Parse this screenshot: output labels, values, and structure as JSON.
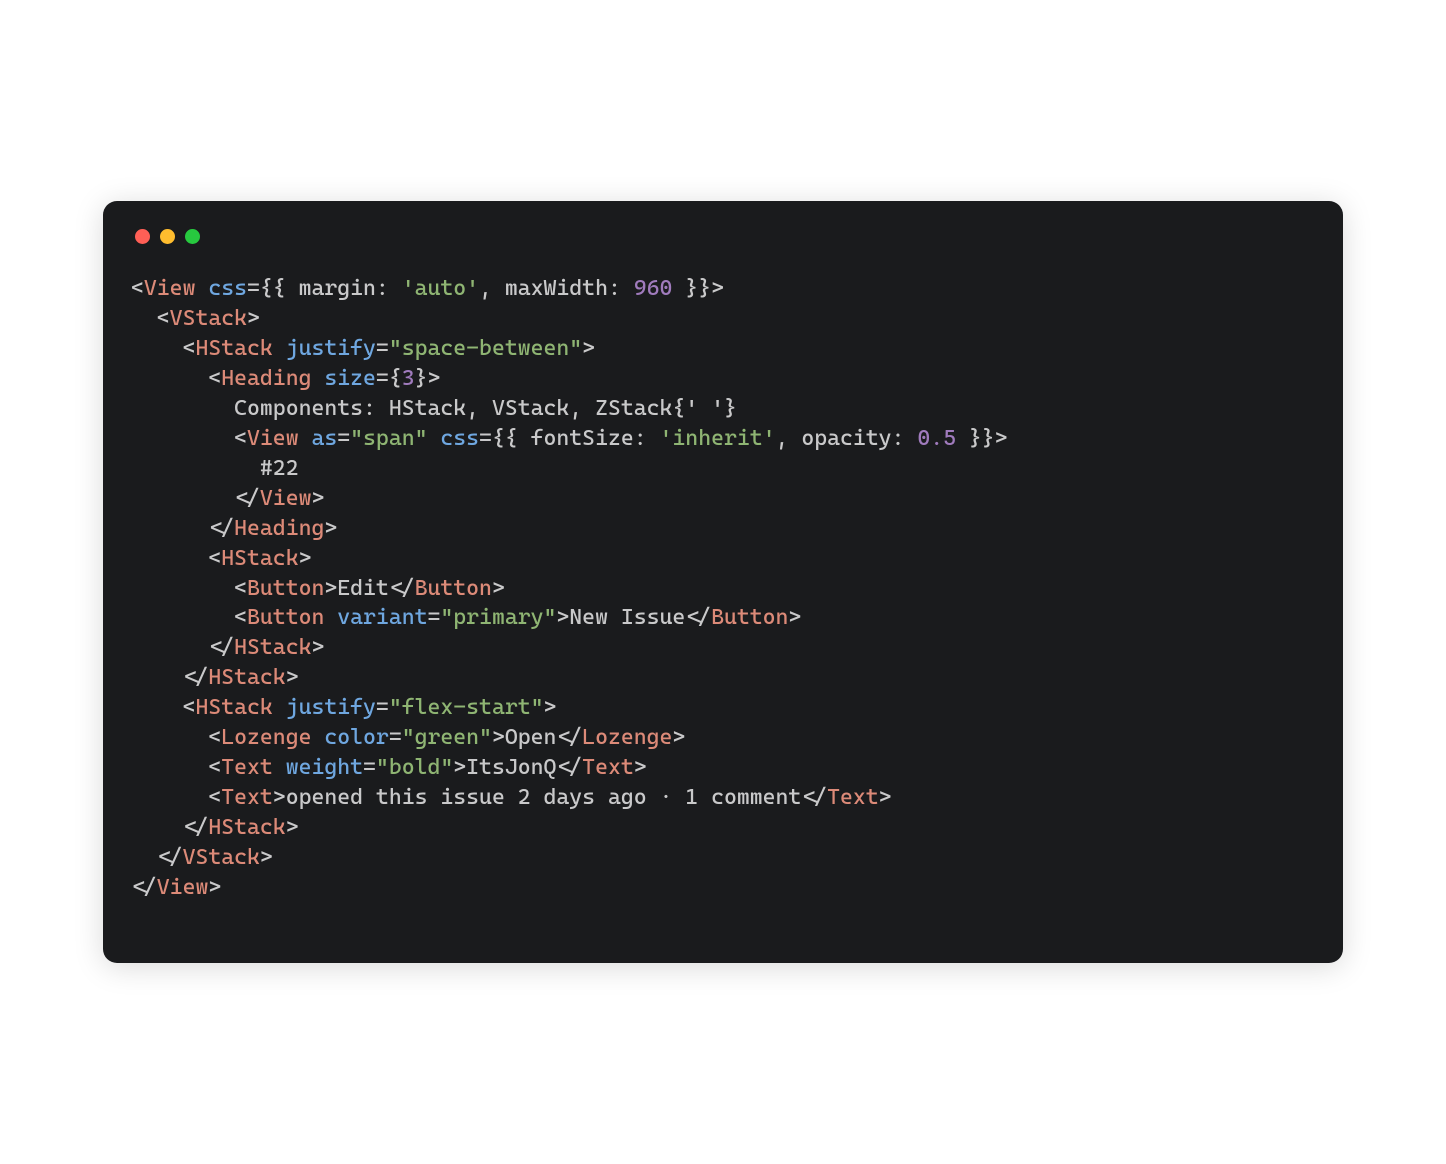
{
  "code": {
    "line1": {
      "tag": "View",
      "attr_css": "css",
      "open": "={{ ",
      "prop_margin": "margin: ",
      "val_margin": "'auto'",
      "sep1": ", ",
      "prop_maxwidth": "maxWidth: ",
      "val_maxwidth": "960",
      "close": " }}"
    },
    "line2": {
      "tag": "VStack"
    },
    "line3": {
      "tag": "HStack",
      "attr": "justify",
      "val": "\"space-between\""
    },
    "line4": {
      "tag": "Heading",
      "attr": "size",
      "eq": "=",
      "expr_open": "{",
      "val": "3",
      "expr_close": "}"
    },
    "line5": {
      "text": "Components: HStack, VStack, ZStack{' '}"
    },
    "line6": {
      "tag": "View",
      "attr_as": "as",
      "val_as": "\"span\"",
      "attr_css": "css",
      "open": "={{ ",
      "prop_fs": "fontSize: ",
      "val_fs": "'inherit'",
      "sep": ", ",
      "prop_op": "opacity: ",
      "val_op": "0.5",
      "close": " }}"
    },
    "line7": {
      "text": "#22"
    },
    "line8": {
      "tag": "View"
    },
    "line9": {
      "tag": "Heading"
    },
    "line10": {
      "tag": "HStack"
    },
    "line11": {
      "tag": "Button",
      "text": "Edit"
    },
    "line12": {
      "tag": "Button",
      "attr": "variant",
      "val": "\"primary\"",
      "text": "New Issue"
    },
    "line13": {
      "tag": "HStack"
    },
    "line14": {
      "tag": "HStack"
    },
    "line15": {
      "tag": "HStack",
      "attr": "justify",
      "val": "\"flex-start\""
    },
    "line16": {
      "tag": "Lozenge",
      "attr": "color",
      "val": "\"green\"",
      "text": "Open"
    },
    "line17": {
      "tag": "Text",
      "attr": "weight",
      "val": "\"bold\"",
      "text": "ItsJonQ"
    },
    "line18": {
      "tag": "Text",
      "text": "opened this issue 2 days ago · 1 comment"
    },
    "line19": {
      "tag": "HStack"
    },
    "line20": {
      "tag": "VStack"
    },
    "line21": {
      "tag": "View"
    }
  }
}
